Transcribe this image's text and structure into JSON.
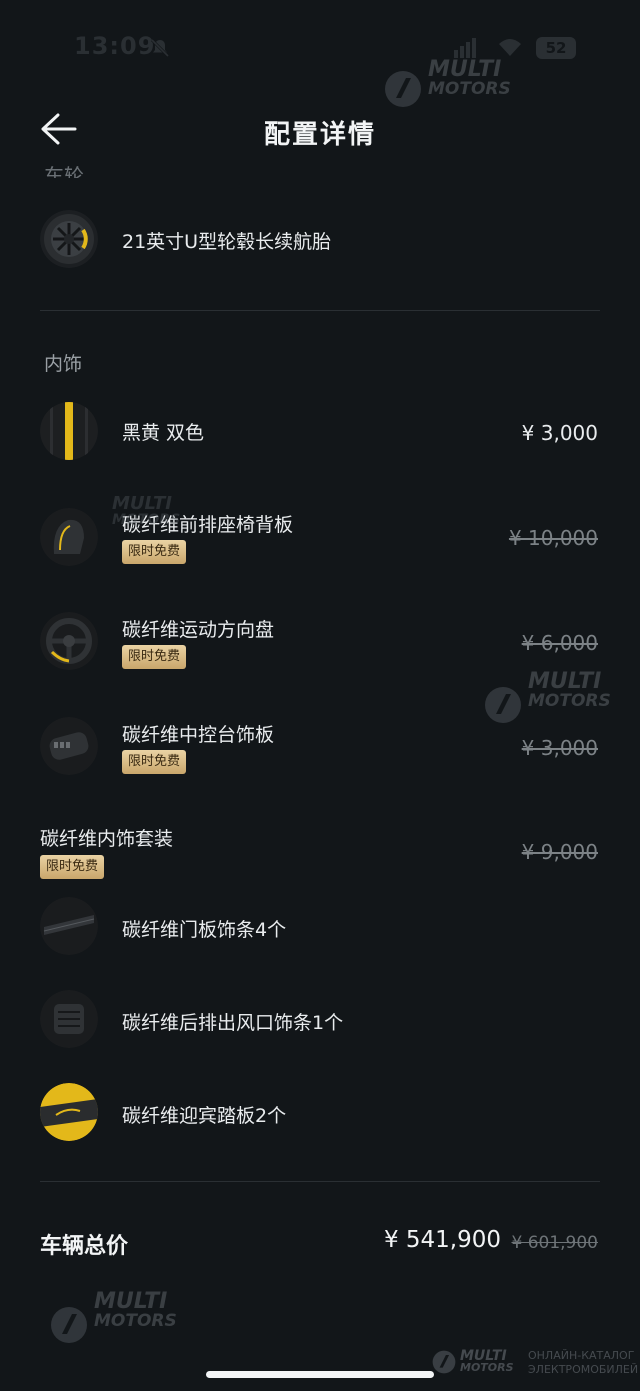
{
  "status_bar": {
    "time": "13:09",
    "battery": "52"
  },
  "header": {
    "title": "配置详情"
  },
  "wheels_section": {
    "title_cut": "车轮",
    "item_name": "21英寸U型轮毂长续航胎"
  },
  "interior_section": {
    "title": "内饰",
    "items": [
      {
        "name": "黑黄 双色",
        "price": "¥ 3,000",
        "struck": false,
        "badge": ""
      },
      {
        "name": "碳纤维前排座椅背板",
        "price": "¥ 10,000",
        "struck": true,
        "badge": "限时免费"
      },
      {
        "name": "碳纤维运动方向盘",
        "price": "¥ 6,000",
        "struck": true,
        "badge": "限时免费"
      },
      {
        "name": "碳纤维中控台饰板",
        "price": "¥ 3,000",
        "struck": true,
        "badge": "限时免费"
      }
    ],
    "package": {
      "name": "碳纤维内饰套装",
      "badge": "限时免费",
      "price": "¥ 9,000",
      "items": [
        {
          "name": "碳纤维门板饰条4个"
        },
        {
          "name": "碳纤维后排出风口饰条1个"
        },
        {
          "name": "碳纤维迎宾踏板2个"
        }
      ]
    }
  },
  "total": {
    "label": "车辆总价",
    "price": "¥ 541,900",
    "original_price": "¥ 601,900"
  },
  "watermark": {
    "line1": "MULTI",
    "line2": "MOTORS",
    "corner_line1": "ОНЛАЙН-КАТАЛОГ",
    "corner_line2": "ЭЛЕКТРОМОБИЛЕЙ"
  },
  "colors": {
    "background": "#121619",
    "badge_gold": "#d9bb84",
    "accent_yellow": "#e3b81a"
  }
}
